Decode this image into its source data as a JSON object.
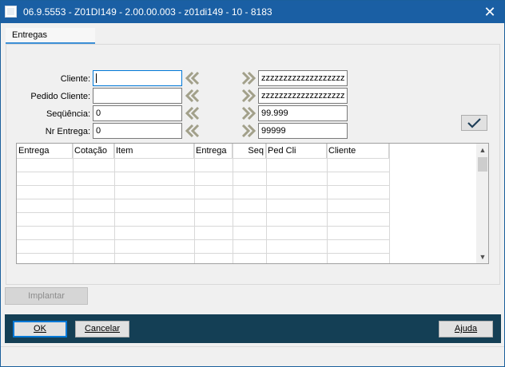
{
  "window": {
    "title": "06.9.5553 - Z01DI149 - 2.00.00.003 - z01di149 - 10 - 8183",
    "close_glyph": "✕"
  },
  "tabs": [
    {
      "label": "Entregas"
    }
  ],
  "filters": [
    {
      "label": "Cliente:",
      "from": "",
      "to": "zzzzzzzzzzzzzzzzzzz"
    },
    {
      "label": "Pedido Cliente:",
      "from": "",
      "to": "zzzzzzzzzzzzzzzzzzz"
    },
    {
      "label": "Seqüência:",
      "from": "0",
      "to": "99.999"
    },
    {
      "label": "Nr Entrega:",
      "from": "0",
      "to": "99999"
    }
  ],
  "grid": {
    "columns": [
      "Entrega",
      "Cotação",
      "Item",
      "Entrega",
      "Seq",
      "Ped Cli",
      "Cliente"
    ]
  },
  "buttons": {
    "implantar": "Implantar",
    "ok": "OK",
    "cancelar": "Cancelar",
    "ajuda": "Ajuda"
  },
  "colors": {
    "titlebar": "#1a5fa4",
    "footer": "#143f55",
    "arrow": "#a2a08a"
  },
  "icons": {
    "left_arrow": "double-chevron-left-icon",
    "right_arrow": "double-chevron-right-icon",
    "confirm": "checkmark-icon"
  }
}
